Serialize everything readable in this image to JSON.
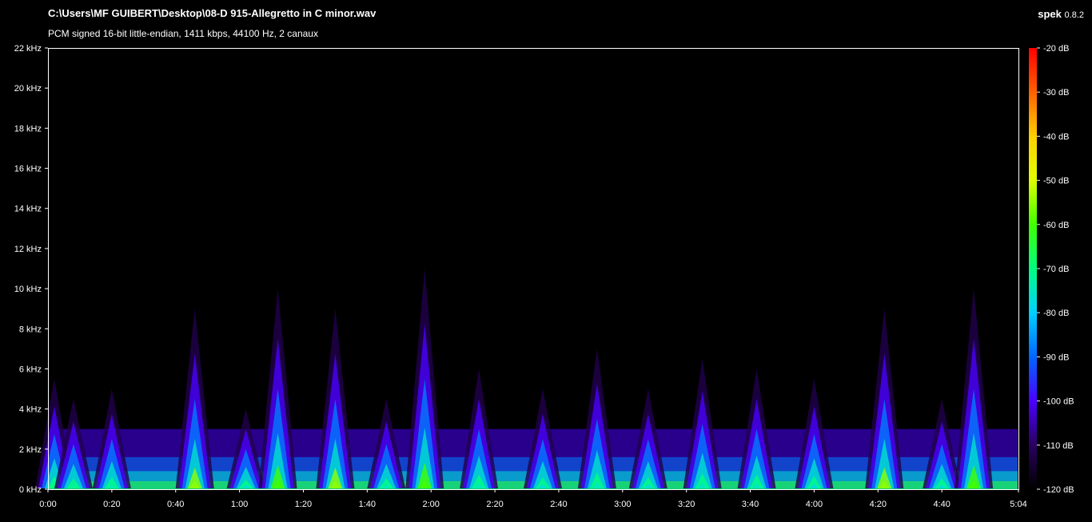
{
  "header": {
    "file_path": "C:\\Users\\MF GUIBERT\\Desktop\\08-D 915-Allegretto in C minor.wav",
    "info": "PCM signed 16-bit little-endian, 1411 kbps, 44100 Hz, 2 canaux",
    "app_name": "spek",
    "app_version": "0.8.2"
  },
  "chart_data": {
    "type": "heatmap",
    "x_unit": "seconds",
    "y_unit": "kHz",
    "xlim": [
      0,
      304
    ],
    "ylim": [
      0,
      22
    ],
    "x_ticks": [
      "0:00",
      "0:20",
      "0:40",
      "1:00",
      "1:20",
      "1:40",
      "2:00",
      "2:20",
      "2:40",
      "3:00",
      "3:20",
      "3:40",
      "4:00",
      "4:20",
      "4:40",
      "5:04"
    ],
    "x_tick_values": [
      0,
      20,
      40,
      60,
      80,
      100,
      120,
      140,
      160,
      180,
      200,
      220,
      240,
      260,
      280,
      304
    ],
    "y_ticks": [
      "0 kHz",
      "2 kHz",
      "4 kHz",
      "6 kHz",
      "8 kHz",
      "10 kHz",
      "12 kHz",
      "14 kHz",
      "16 kHz",
      "18 kHz",
      "20 kHz",
      "22 kHz"
    ],
    "y_tick_values": [
      0,
      2,
      4,
      6,
      8,
      10,
      12,
      14,
      16,
      18,
      20,
      22
    ],
    "colorbar": {
      "unit": "dB",
      "range": [
        -120,
        -20
      ],
      "ticks": [
        "-20 dB",
        "-30 dB",
        "-40 dB",
        "-50 dB",
        "-60 dB",
        "-70 dB",
        "-80 dB",
        "-90 dB",
        "-100 dB",
        "-110 dB",
        "-120 dB"
      ],
      "tick_values": [
        -20,
        -30,
        -40,
        -50,
        -60,
        -70,
        -80,
        -90,
        -100,
        -110,
        -120
      ],
      "colors": [
        "#000000",
        "#2a0060",
        "#4a00ff",
        "#0066ff",
        "#00d0ff",
        "#00ff80",
        "#40ff00",
        "#e0ff00",
        "#ffd000",
        "#ff6000",
        "#ff0000"
      ]
    },
    "energy_peaks": [
      {
        "time_s": 2,
        "top_khz": 5.5,
        "level_db": -70
      },
      {
        "time_s": 8,
        "top_khz": 4.5,
        "level_db": -72
      },
      {
        "time_s": 20,
        "top_khz": 5.0,
        "level_db": -74
      },
      {
        "time_s": 46,
        "top_khz": 9.0,
        "level_db": -55
      },
      {
        "time_s": 62,
        "top_khz": 4.0,
        "level_db": -78
      },
      {
        "time_s": 72,
        "top_khz": 10.0,
        "level_db": -60
      },
      {
        "time_s": 90,
        "top_khz": 9.0,
        "level_db": -55
      },
      {
        "time_s": 106,
        "top_khz": 4.5,
        "level_db": -75
      },
      {
        "time_s": 118,
        "top_khz": 11.0,
        "level_db": -60
      },
      {
        "time_s": 135,
        "top_khz": 6.0,
        "level_db": -75
      },
      {
        "time_s": 155,
        "top_khz": 5.0,
        "level_db": -78
      },
      {
        "time_s": 172,
        "top_khz": 7.0,
        "level_db": -75
      },
      {
        "time_s": 188,
        "top_khz": 5.0,
        "level_db": -78
      },
      {
        "time_s": 205,
        "top_khz": 6.5,
        "level_db": -76
      },
      {
        "time_s": 222,
        "top_khz": 6.0,
        "level_db": -76
      },
      {
        "time_s": 240,
        "top_khz": 5.5,
        "level_db": -78
      },
      {
        "time_s": 262,
        "top_khz": 9.0,
        "level_db": -55
      },
      {
        "time_s": 280,
        "top_khz": 4.5,
        "level_db": -78
      },
      {
        "time_s": 290,
        "top_khz": 10.0,
        "level_db": -60
      }
    ]
  }
}
